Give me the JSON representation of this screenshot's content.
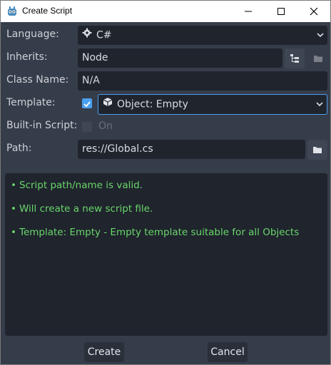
{
  "window": {
    "title": "Create Script",
    "controls": {
      "minimize": "minimize-icon",
      "maximize": "maximize-icon",
      "close": "close-icon"
    }
  },
  "form": {
    "language": {
      "label": "Language:",
      "value": "C#",
      "icon": "gear-icon"
    },
    "inherits": {
      "label": "Inherits:",
      "value": "Node"
    },
    "class_name": {
      "label": "Class Name:",
      "value": "N/A"
    },
    "template": {
      "label": "Template:",
      "enabled": true,
      "value": "Object: Empty",
      "icon": "cube-icon"
    },
    "builtin": {
      "label": "Built-in Script:",
      "checked": false,
      "toggle_label": "On"
    },
    "path": {
      "label": "Path:",
      "value": "res://Global.cs"
    }
  },
  "messages": [
    "Script path/name is valid.",
    "Will create a new script file.",
    "Template: Empty - Empty template suitable for all Objects"
  ],
  "buttons": {
    "create": "Create",
    "cancel": "Cancel"
  },
  "colors": {
    "accent": "#4aa0f0",
    "valid_text": "#6ad66a",
    "field_bg": "#1f242d",
    "panel_bg": "#363d4a"
  }
}
